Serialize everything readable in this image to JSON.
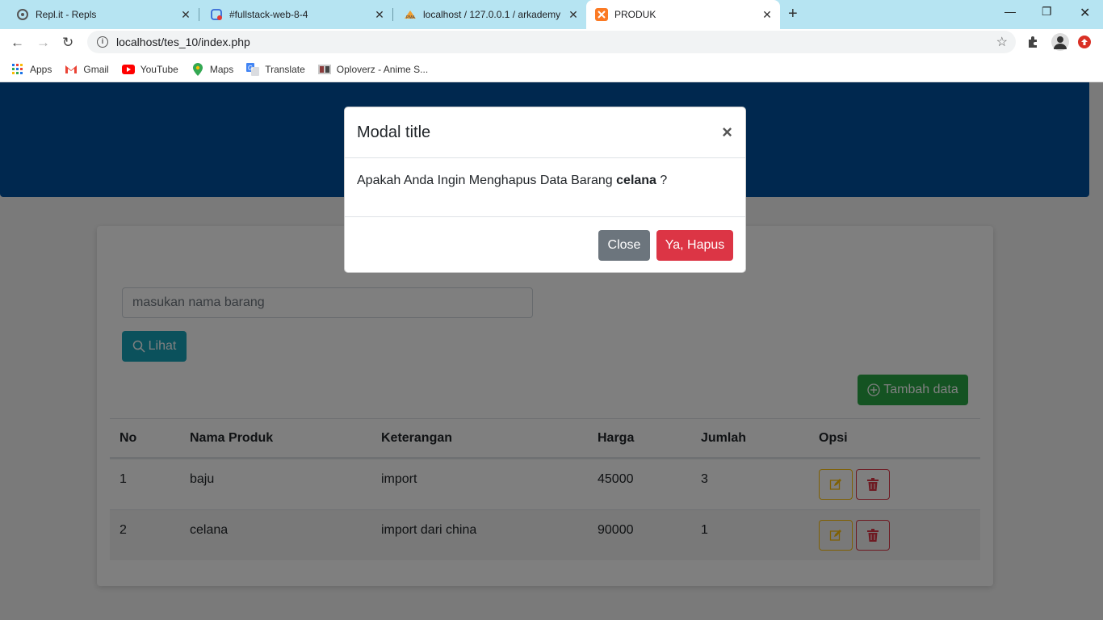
{
  "browser": {
    "tabs": [
      {
        "title": "Repl.it - Repls"
      },
      {
        "title": "#fullstack-web-8-4"
      },
      {
        "title": "localhost / 127.0.0.1 / arkademy"
      },
      {
        "title": "PRODUK"
      }
    ],
    "url": "localhost/tes_10/index.php",
    "bookmarks": [
      {
        "label": "Apps"
      },
      {
        "label": "Gmail"
      },
      {
        "label": "YouTube"
      },
      {
        "label": "Maps"
      },
      {
        "label": "Translate"
      },
      {
        "label": "Oploverz - Anime S..."
      }
    ]
  },
  "search": {
    "placeholder": "masukan nama barang",
    "button_label": "Lihat"
  },
  "add_button_label": "Tambah data",
  "table": {
    "headers": [
      "No",
      "Nama Produk",
      "Keterangan",
      "Harga",
      "Jumlah",
      "Opsi"
    ],
    "rows": [
      [
        "1",
        "baju",
        "import",
        "45000",
        "3"
      ],
      [
        "2",
        "celana",
        "import dari china",
        "90000",
        "1"
      ]
    ]
  },
  "modal": {
    "title": "Modal title",
    "body_prefix": "Apakah Anda Ingin Menghapus Data Barang",
    "body_item": "celana",
    "body_suffix": "?",
    "close_label": "Close",
    "confirm_label": "Ya, Hapus"
  },
  "colors": {
    "hero": "#01509e",
    "info": "#17a2b8",
    "success": "#28a745",
    "danger": "#dc3545",
    "warning": "#ffc107",
    "secondary": "#6c757d"
  }
}
